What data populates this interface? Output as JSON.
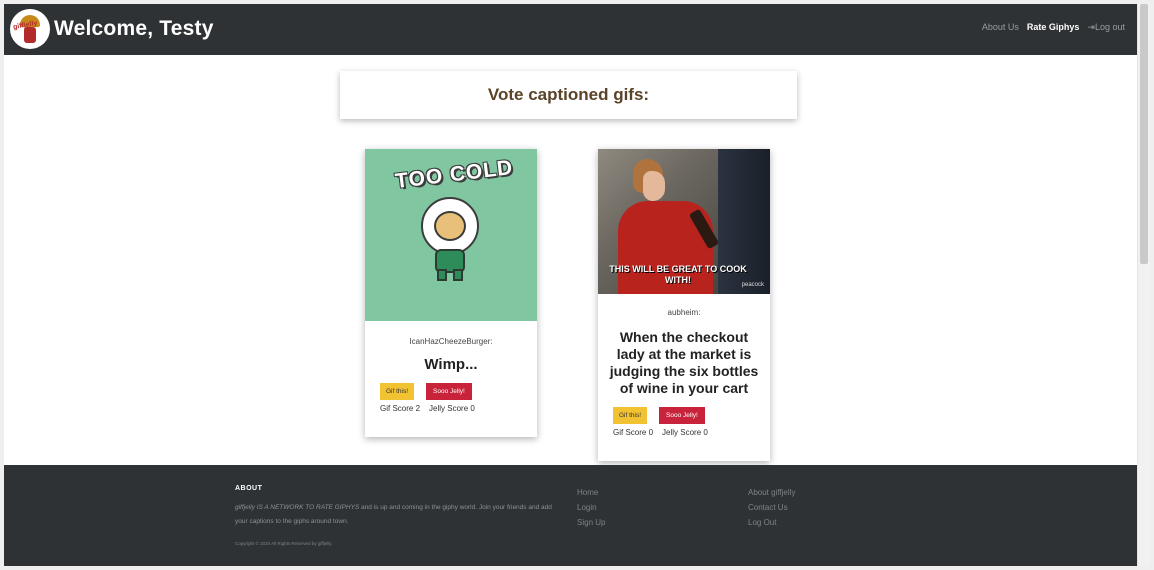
{
  "navbar": {
    "logo_text": "giffjelly",
    "welcome": "Welcome, Testy",
    "links": [
      "About Us",
      "Rate Giphys",
      "Log out"
    ],
    "logout_icon": "⇥"
  },
  "vote_header": {
    "title": "Vote captioned gifs:"
  },
  "cards": [
    {
      "gif_text": "TOO COLD",
      "author": "IcanHazCheezeBurger:",
      "caption": "Wimp...",
      "gif_button": "Gif this!",
      "jelly_button": "Sooo Jelly!",
      "gif_score": "Gif Score 2",
      "jelly_score": "Jelly Score 0"
    },
    {
      "gif_text": "THIS WILL BE GREAT TO COOK WITH!",
      "watermark": "peacock",
      "author": "aubheim:",
      "caption": "When the checkout lady at the market is judging the six bottles of wine in your cart",
      "gif_button": "Gif this!",
      "jelly_button": "Sooo Jelly!",
      "gif_score": "Gif Score 0",
      "jelly_score": "Jelly Score 0"
    }
  ],
  "footer": {
    "about_title": "ABOUT",
    "about_emph": "giffjelly IS A NETWORK TO RATE GIPHYS",
    "about_rest": " and is up and coming in the giphy world. Join your friends and add your captions to the giphs around town.",
    "copyright": "Copyright © 2020 All Rights Reserved by giffjelly.",
    "col1": [
      "Home",
      "Login",
      "Sign Up"
    ],
    "col2": [
      "About giffjelly",
      "Contact Us",
      "Log Out"
    ]
  },
  "colors": {
    "navbar": "#2f3234",
    "gif_button": "#f1c232",
    "jelly_button": "#c8233a",
    "heading": "#5a4328"
  }
}
